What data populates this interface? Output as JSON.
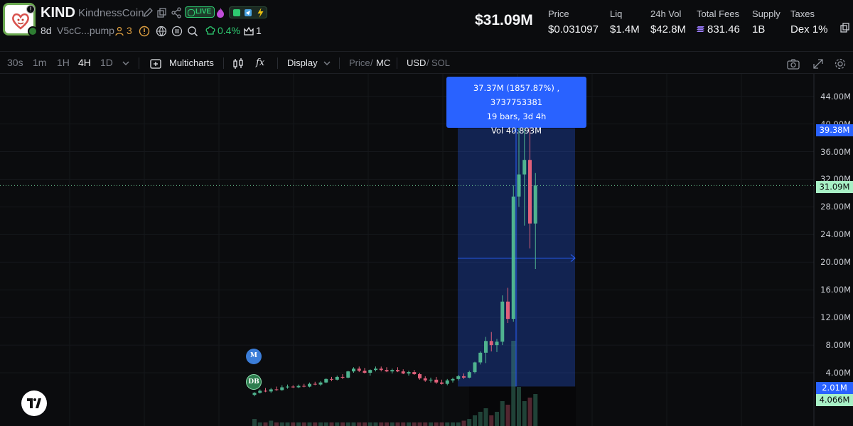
{
  "token": {
    "ticker": "KIND",
    "name": "KindnessCoin",
    "live_label": "LIVE",
    "age": "8d",
    "address": "V5cC...pump",
    "holders": "3",
    "holders_pct": "0.4%",
    "crowns": "1"
  },
  "header_stats": {
    "market_cap": "$31.09M",
    "price_label": "Price",
    "price": "$0.031097",
    "liq_label": "Liq",
    "liq": "$1.4M",
    "vol_label": "24h Vol",
    "vol": "$42.8M",
    "fees_label": "Total Fees",
    "fees": "831.46",
    "supply_label": "Supply",
    "supply": "1B",
    "taxes_label": "Taxes",
    "taxes": "Dex 1%"
  },
  "toolbar": {
    "timeframes": [
      "30s",
      "1m",
      "1H",
      "4H",
      "1D"
    ],
    "active_timeframe": "4H",
    "multicharts": "Multicharts",
    "fx": "fx",
    "display": "Display",
    "price_label": "Price",
    "mc_label": "MC",
    "usd_label": "USD",
    "sol_label": "SOL"
  },
  "tooltip": {
    "line1": "37.37M (1857.87%) , 3737753381",
    "line2": "19 bars, 3d 4h",
    "line3": "Vol 40.893M"
  },
  "markers": {
    "m": "M",
    "db": "DB"
  },
  "colors": {
    "up": "#4fb38f",
    "down": "#e0607a",
    "accent": "#2962ff",
    "bg": "#0b0c0e"
  },
  "chart_data": {
    "type": "candlestick",
    "y_unit": "market cap (USD)",
    "yticks": [
      "4.00M",
      "8.00M",
      "12.00M",
      "16.00M",
      "20.00M",
      "24.00M",
      "28.00M",
      "32.00M",
      "36.00M",
      "40.00M",
      "44.00M"
    ],
    "ylim": [
      0,
      46
    ],
    "tags": {
      "current": "31.09M",
      "range_high": "39.38M",
      "range_low": "2.01M",
      "volume": "4.066M"
    },
    "candles": [
      {
        "o": 0.8,
        "h": 1.2,
        "l": 0.6,
        "c": 1.1
      },
      {
        "o": 1.1,
        "h": 1.6,
        "l": 1.0,
        "c": 1.4
      },
      {
        "o": 1.4,
        "h": 1.8,
        "l": 1.2,
        "c": 1.3
      },
      {
        "o": 1.3,
        "h": 1.8,
        "l": 1.1,
        "c": 1.6
      },
      {
        "o": 1.6,
        "h": 2.0,
        "l": 1.4,
        "c": 1.5
      },
      {
        "o": 1.5,
        "h": 2.2,
        "l": 1.4,
        "c": 1.9
      },
      {
        "o": 1.9,
        "h": 2.3,
        "l": 1.7,
        "c": 2.0
      },
      {
        "o": 2.0,
        "h": 2.2,
        "l": 1.8,
        "c": 1.9
      },
      {
        "o": 1.9,
        "h": 2.3,
        "l": 1.8,
        "c": 2.1
      },
      {
        "o": 2.1,
        "h": 2.4,
        "l": 1.9,
        "c": 2.0
      },
      {
        "o": 2.0,
        "h": 2.6,
        "l": 1.9,
        "c": 2.4
      },
      {
        "o": 2.4,
        "h": 2.7,
        "l": 2.2,
        "c": 2.3
      },
      {
        "o": 2.3,
        "h": 2.8,
        "l": 2.1,
        "c": 2.6
      },
      {
        "o": 2.6,
        "h": 3.2,
        "l": 2.5,
        "c": 3.1
      },
      {
        "o": 3.1,
        "h": 3.4,
        "l": 2.8,
        "c": 3.0
      },
      {
        "o": 3.0,
        "h": 3.6,
        "l": 2.9,
        "c": 3.4
      },
      {
        "o": 3.4,
        "h": 3.8,
        "l": 3.1,
        "c": 3.3
      },
      {
        "o": 3.3,
        "h": 4.3,
        "l": 3.2,
        "c": 4.2
      },
      {
        "o": 4.2,
        "h": 4.8,
        "l": 4.0,
        "c": 4.6
      },
      {
        "o": 4.6,
        "h": 4.9,
        "l": 4.1,
        "c": 4.3
      },
      {
        "o": 4.3,
        "h": 4.7,
        "l": 3.9,
        "c": 4.0
      },
      {
        "o": 4.0,
        "h": 4.5,
        "l": 3.6,
        "c": 4.4
      },
      {
        "o": 4.4,
        "h": 4.9,
        "l": 4.2,
        "c": 4.6
      },
      {
        "o": 4.6,
        "h": 4.9,
        "l": 4.2,
        "c": 4.4
      },
      {
        "o": 4.4,
        "h": 4.8,
        "l": 4.1,
        "c": 4.2
      },
      {
        "o": 4.2,
        "h": 4.6,
        "l": 3.9,
        "c": 4.4
      },
      {
        "o": 4.4,
        "h": 4.8,
        "l": 4.1,
        "c": 4.2
      },
      {
        "o": 4.2,
        "h": 4.5,
        "l": 3.8,
        "c": 3.9
      },
      {
        "o": 3.9,
        "h": 4.3,
        "l": 3.6,
        "c": 4.1
      },
      {
        "o": 4.1,
        "h": 4.4,
        "l": 3.7,
        "c": 3.8
      },
      {
        "o": 3.8,
        "h": 4.0,
        "l": 3.0,
        "c": 3.2
      },
      {
        "o": 3.2,
        "h": 3.5,
        "l": 2.7,
        "c": 2.9
      },
      {
        "o": 2.9,
        "h": 3.3,
        "l": 2.6,
        "c": 3.0
      },
      {
        "o": 3.0,
        "h": 3.4,
        "l": 2.4,
        "c": 2.6
      },
      {
        "o": 2.6,
        "h": 3.0,
        "l": 2.3,
        "c": 2.4
      },
      {
        "o": 2.4,
        "h": 3.1,
        "l": 2.2,
        "c": 2.9
      },
      {
        "o": 2.9,
        "h": 3.3,
        "l": 2.6,
        "c": 3.1
      },
      {
        "o": 3.1,
        "h": 3.7,
        "l": 2.9,
        "c": 3.5
      },
      {
        "o": 3.5,
        "h": 3.9,
        "l": 3.1,
        "c": 3.3
      },
      {
        "o": 3.3,
        "h": 4.3,
        "l": 3.2,
        "c": 4.1
      },
      {
        "o": 4.1,
        "h": 5.6,
        "l": 3.9,
        "c": 5.5
      },
      {
        "o": 5.5,
        "h": 7.1,
        "l": 5.2,
        "c": 6.9
      },
      {
        "o": 6.9,
        "h": 9.2,
        "l": 5.4,
        "c": 8.6
      },
      {
        "o": 8.6,
        "h": 9.9,
        "l": 7.1,
        "c": 8.0
      },
      {
        "o": 8.0,
        "h": 8.9,
        "l": 7.0,
        "c": 8.5
      },
      {
        "o": 8.5,
        "h": 15.2,
        "l": 8.0,
        "c": 14.3
      },
      {
        "o": 14.3,
        "h": 16.3,
        "l": 11.2,
        "c": 11.8
      },
      {
        "o": 11.8,
        "h": 31.1,
        "l": 11.4,
        "c": 29.5
      },
      {
        "o": 29.5,
        "h": 41.8,
        "l": 28.0,
        "c": 32.7
      },
      {
        "o": 32.7,
        "h": 39.4,
        "l": 25.3,
        "c": 34.8
      },
      {
        "o": 34.8,
        "h": 41.8,
        "l": 22.0,
        "c": 25.6
      },
      {
        "o": 25.6,
        "h": 32.9,
        "l": 19.0,
        "c": 31.1
      }
    ],
    "volume_relative": [
      0.2,
      0.1,
      0.1,
      0.15,
      0.1,
      0.1,
      0.1,
      0.1,
      0.1,
      0.1,
      0.1,
      0.1,
      0.1,
      0.1,
      0.1,
      0.1,
      0.1,
      0.1,
      0.1,
      0.1,
      0.1,
      0.1,
      0.1,
      0.1,
      0.1,
      0.1,
      0.1,
      0.1,
      0.1,
      0.1,
      0.1,
      0.1,
      0.1,
      0.1,
      0.1,
      0.1,
      0.1,
      0.1,
      0.15,
      0.2,
      0.3,
      0.4,
      0.5,
      0.3,
      0.4,
      0.7,
      0.6,
      2.4,
      1.1,
      0.7,
      0.8,
      0.9
    ]
  }
}
